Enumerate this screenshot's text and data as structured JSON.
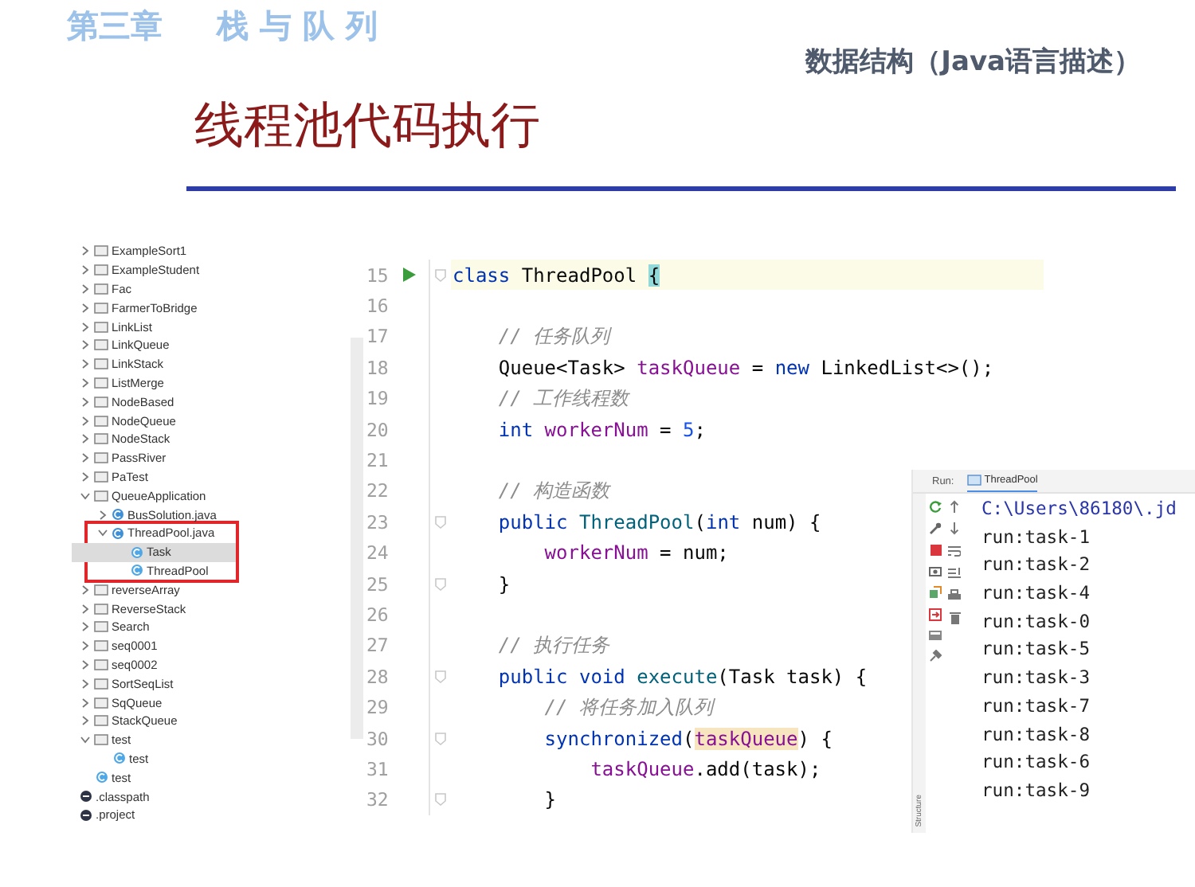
{
  "chapter": {
    "number": "第三章",
    "title": "栈 与 队 列"
  },
  "book_title": "数据结构（Java语言描述）",
  "slide_title": "线程池代码执行",
  "project_tree": [
    {
      "label": "ExampleSort1",
      "kind": "folder",
      "expanded": false,
      "selected": false
    },
    {
      "label": "ExampleStudent",
      "kind": "folder",
      "expanded": false,
      "selected": false
    },
    {
      "label": "Fac",
      "kind": "folder",
      "expanded": false,
      "selected": false
    },
    {
      "label": "FarmerToBridge",
      "kind": "folder",
      "expanded": false,
      "selected": false
    },
    {
      "label": "LinkList",
      "kind": "folder",
      "expanded": false,
      "selected": false
    },
    {
      "label": "LinkQueue",
      "kind": "folder",
      "expanded": false,
      "selected": false
    },
    {
      "label": "LinkStack",
      "kind": "folder",
      "expanded": false,
      "selected": false
    },
    {
      "label": "ListMerge",
      "kind": "folder",
      "expanded": false,
      "selected": false
    },
    {
      "label": "NodeBased",
      "kind": "folder",
      "expanded": false,
      "selected": false
    },
    {
      "label": "NodeQueue",
      "kind": "folder",
      "expanded": false,
      "selected": false
    },
    {
      "label": "NodeStack",
      "kind": "folder",
      "expanded": false,
      "selected": false
    },
    {
      "label": "PassRiver",
      "kind": "folder",
      "expanded": false,
      "selected": false
    },
    {
      "label": "PaTest",
      "kind": "folder",
      "expanded": false,
      "selected": false
    },
    {
      "label": "QueueApplication",
      "kind": "folder",
      "expanded": true,
      "selected": false,
      "children": [
        {
          "label": "BusSolution.java",
          "kind": "java-file",
          "expanded": false,
          "selected": false
        },
        {
          "label": "ThreadPool.java",
          "kind": "java-file",
          "expanded": true,
          "selected": false,
          "highlighted": true,
          "children": [
            {
              "label": "Task",
              "kind": "class",
              "selected": true
            },
            {
              "label": "ThreadPool",
              "kind": "class",
              "selected": false
            }
          ]
        }
      ]
    },
    {
      "label": "reverseArray",
      "kind": "folder",
      "expanded": false,
      "selected": false
    },
    {
      "label": "ReverseStack",
      "kind": "folder",
      "expanded": false,
      "selected": false
    },
    {
      "label": "Search",
      "kind": "folder",
      "expanded": false,
      "selected": false
    },
    {
      "label": "seq0001",
      "kind": "folder",
      "expanded": false,
      "selected": false
    },
    {
      "label": "seq0002",
      "kind": "folder",
      "expanded": false,
      "selected": false
    },
    {
      "label": "SortSeqList",
      "kind": "folder",
      "expanded": false,
      "selected": false
    },
    {
      "label": "SqQueue",
      "kind": "folder",
      "expanded": false,
      "selected": false
    },
    {
      "label": "StackQueue",
      "kind": "folder",
      "expanded": false,
      "selected": false
    },
    {
      "label": "test",
      "kind": "folder",
      "expanded": true,
      "selected": false,
      "children": [
        {
          "label": "test",
          "kind": "class",
          "selected": false
        }
      ]
    },
    {
      "label": "test",
      "kind": "class",
      "selected": false
    },
    {
      "label": ".classpath",
      "kind": "file",
      "selected": false
    },
    {
      "label": ".project",
      "kind": "file",
      "selected": false
    }
  ],
  "editor": {
    "lines": [
      {
        "number": "15",
        "run_marker": true,
        "current": true,
        "fold": true,
        "tokens": [
          {
            "text": "class",
            "kind": "keyword"
          },
          {
            "text": " ThreadPool ",
            "kind": "plain"
          },
          {
            "text": "{",
            "kind": "brace_match"
          }
        ]
      },
      {
        "number": "16",
        "run_marker": false,
        "current": false,
        "fold": false
      },
      {
        "number": "17",
        "run_marker": false,
        "current": false,
        "fold": false,
        "tokens": [
          {
            "text": "    // 任务队列",
            "kind": "comment"
          }
        ]
      },
      {
        "number": "18",
        "run_marker": false,
        "current": false,
        "fold": false,
        "tokens": [
          {
            "text": "    Queue<Task> ",
            "kind": "plain"
          },
          {
            "text": "taskQueue",
            "kind": "field"
          },
          {
            "text": " = ",
            "kind": "plain"
          },
          {
            "text": "new",
            "kind": "keyword"
          },
          {
            "text": " LinkedList<>();",
            "kind": "plain"
          }
        ]
      },
      {
        "number": "19",
        "run_marker": false,
        "current": false,
        "fold": false,
        "tokens": [
          {
            "text": "    // 工作线程数",
            "kind": "comment"
          }
        ]
      },
      {
        "number": "20",
        "run_marker": false,
        "current": false,
        "fold": false,
        "tokens": [
          {
            "text": "    int",
            "kind": "keyword"
          },
          {
            "text": " workerNum",
            "kind": "field"
          },
          {
            "text": " = ",
            "kind": "plain"
          },
          {
            "text": "5",
            "kind": "number"
          },
          {
            "text": ";",
            "kind": "plain"
          }
        ]
      },
      {
        "number": "21",
        "run_marker": false,
        "current": false,
        "fold": false
      },
      {
        "number": "22",
        "run_marker": false,
        "current": false,
        "fold": false,
        "tokens": [
          {
            "text": "    // 构造函数",
            "kind": "comment"
          }
        ]
      },
      {
        "number": "23",
        "run_marker": false,
        "current": false,
        "fold": true,
        "tokens": [
          {
            "text": "    public",
            "kind": "keyword"
          },
          {
            "text": " ThreadPool",
            "kind": "method"
          },
          {
            "text": "(",
            "kind": "plain"
          },
          {
            "text": "int",
            "kind": "keyword"
          },
          {
            "text": " num) {",
            "kind": "plain"
          }
        ]
      },
      {
        "number": "24",
        "run_marker": false,
        "current": false,
        "fold": false,
        "tokens": [
          {
            "text": "        workerNum",
            "kind": "field"
          },
          {
            "text": " = num;",
            "kind": "plain"
          }
        ]
      },
      {
        "number": "25",
        "run_marker": false,
        "current": false,
        "fold": true,
        "tokens": [
          {
            "text": "    }",
            "kind": "plain"
          }
        ]
      },
      {
        "number": "26",
        "run_marker": false,
        "current": false,
        "fold": false
      },
      {
        "number": "27",
        "run_marker": false,
        "current": false,
        "fold": false,
        "tokens": [
          {
            "text": "    // 执行任务",
            "kind": "comment"
          }
        ]
      },
      {
        "number": "28",
        "run_marker": false,
        "current": false,
        "fold": true,
        "tokens": [
          {
            "text": "    public",
            "kind": "keyword"
          },
          {
            "text": " void",
            "kind": "keyword"
          },
          {
            "text": " execute",
            "kind": "method"
          },
          {
            "text": "(Task task) {",
            "kind": "plain"
          }
        ]
      },
      {
        "number": "29",
        "run_marker": false,
        "current": false,
        "fold": false,
        "tokens": [
          {
            "text": "        // 将任务加入队列",
            "kind": "comment"
          }
        ]
      },
      {
        "number": "30",
        "run_marker": false,
        "current": false,
        "fold": true,
        "tokens": [
          {
            "text": "        synchronized",
            "kind": "keyword"
          },
          {
            "text": "(",
            "kind": "plain"
          },
          {
            "text": "taskQueue",
            "kind": "usage_highlight"
          },
          {
            "text": ") {",
            "kind": "plain"
          }
        ]
      },
      {
        "number": "31",
        "run_marker": false,
        "current": false,
        "fold": false,
        "tokens": [
          {
            "text": "            taskQueue",
            "kind": "field"
          },
          {
            "text": ".add(task);",
            "kind": "plain"
          }
        ]
      },
      {
        "number": "32",
        "run_marker": false,
        "current": false,
        "fold": true,
        "tokens": [
          {
            "text": "        }",
            "kind": "plain"
          }
        ]
      }
    ]
  },
  "run_panel": {
    "label": "Run:",
    "tab": "ThreadPool",
    "side_label": "Structure",
    "output": [
      {
        "text": "C:\\Users\\86180\\.jd",
        "kind": "command"
      },
      {
        "text": "run:task-1",
        "kind": "stdout"
      },
      {
        "text": "run:task-2",
        "kind": "stdout"
      },
      {
        "text": "run:task-4",
        "kind": "stdout"
      },
      {
        "text": "run:task-0",
        "kind": "stdout"
      },
      {
        "text": "run:task-5",
        "kind": "stdout"
      },
      {
        "text": "run:task-3",
        "kind": "stdout"
      },
      {
        "text": "run:task-7",
        "kind": "stdout"
      },
      {
        "text": "run:task-8",
        "kind": "stdout"
      },
      {
        "text": "run:task-6",
        "kind": "stdout"
      },
      {
        "text": "run:task-9",
        "kind": "stdout"
      }
    ]
  }
}
